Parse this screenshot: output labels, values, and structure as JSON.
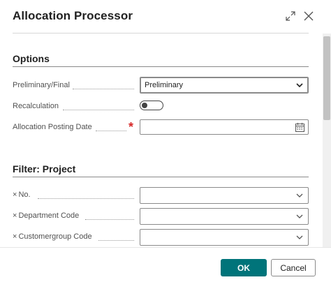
{
  "dialog": {
    "title": "Allocation Processor"
  },
  "options": {
    "group_title": "Options",
    "preliminary_final": {
      "label": "Preliminary/Final",
      "value": "Preliminary"
    },
    "recalculation": {
      "label": "Recalculation",
      "enabled": false
    },
    "posting_date": {
      "label": "Allocation Posting Date",
      "required_mark": "*",
      "value": ""
    }
  },
  "filter": {
    "group_title": "Filter: Project",
    "remove_glyph": "×",
    "fields": [
      {
        "label": "No.",
        "value": ""
      },
      {
        "label": "Department Code",
        "value": ""
      },
      {
        "label": "Customergroup Code",
        "value": ""
      }
    ]
  },
  "footer": {
    "ok_label": "OK",
    "cancel_label": "Cancel"
  },
  "colors": {
    "primary": "#00747a",
    "required": "#d62828"
  },
  "icons": {
    "expand": "expand-icon",
    "close": "close-icon",
    "chevron": "chevron-down-icon",
    "calendar": "calendar-icon"
  }
}
